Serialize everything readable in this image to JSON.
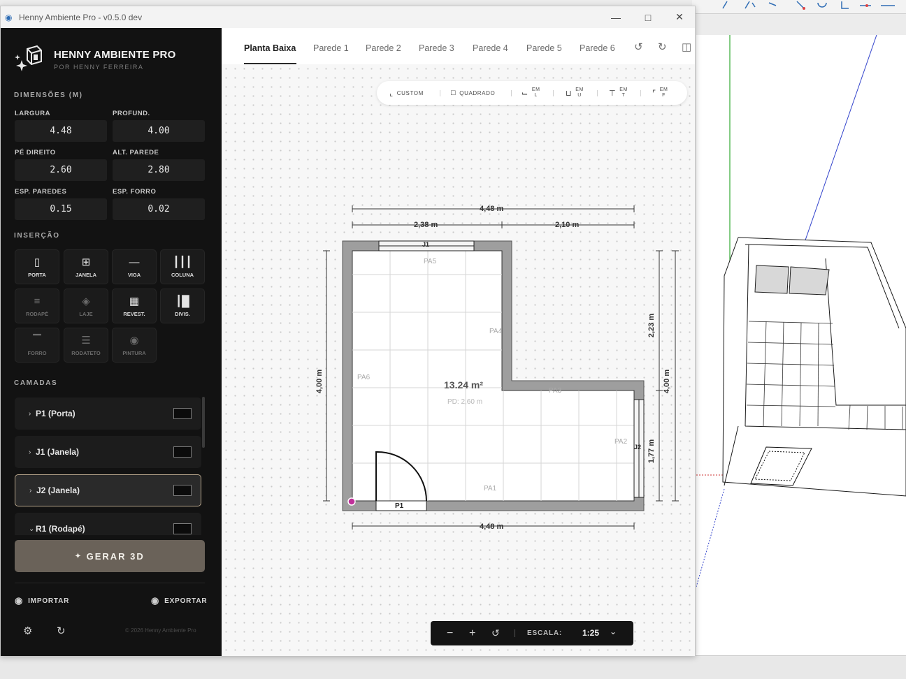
{
  "window": {
    "title": "Henny Ambiente Pro - v0.5.0 dev"
  },
  "brand": {
    "name": "HENNY AMBIENTE PRO",
    "subtitle": "POR HENNY FERREIRA"
  },
  "dimensions": {
    "section_title": "DIMENSÕES (M)",
    "fields": [
      {
        "label": "LARGURA",
        "value": "4.48"
      },
      {
        "label": "PROFUND.",
        "value": "4.00"
      },
      {
        "label": "PÉ DIREITO",
        "value": "2.60"
      },
      {
        "label": "ALT. PAREDE",
        "value": "2.80"
      },
      {
        "label": "ESP. PAREDES",
        "value": "0.15"
      },
      {
        "label": "ESP. FORRO",
        "value": "0.02"
      }
    ]
  },
  "insertion": {
    "section_title": "INSERÇÃO",
    "buttons": [
      {
        "label": "PORTA",
        "icon": "door-icon",
        "enabled": true
      },
      {
        "label": "JANELA",
        "icon": "window-icon",
        "enabled": true
      },
      {
        "label": "VIGA",
        "icon": "beam-icon",
        "enabled": true
      },
      {
        "label": "COLUNA",
        "icon": "column-icon",
        "enabled": true
      },
      {
        "label": "RODAPÉ",
        "icon": "baseboard-icon",
        "enabled": false
      },
      {
        "label": "LAJE",
        "icon": "slab-icon",
        "enabled": false
      },
      {
        "label": "REVEST.",
        "icon": "tile-icon",
        "enabled": true
      },
      {
        "label": "DIVIS.",
        "icon": "divider-icon",
        "enabled": true
      },
      {
        "label": "FORRO",
        "icon": "ceiling-icon",
        "enabled": false
      },
      {
        "label": "RODATETO",
        "icon": "crown-molding-icon",
        "enabled": false
      },
      {
        "label": "PINTURA",
        "icon": "paint-icon",
        "enabled": false
      }
    ]
  },
  "layers": {
    "section_title": "CAMADAS",
    "items": [
      {
        "name": "P1 (Porta)",
        "expanded": false,
        "selected": false
      },
      {
        "name": "J1 (Janela)",
        "expanded": false,
        "selected": false
      },
      {
        "name": "J2 (Janela)",
        "expanded": false,
        "selected": true
      },
      {
        "name": "R1 (Rodapé)",
        "expanded": true,
        "selected": false
      }
    ]
  },
  "actions": {
    "generate": "GERAR 3D",
    "import": "IMPORTAR",
    "export": "EXPORTAR"
  },
  "footer": {
    "copyright": "© 2026 Henny Ambiente Pro"
  },
  "tabs": [
    "Planta Baixa",
    "Parede 1",
    "Parede 2",
    "Parede 3",
    "Parede 4",
    "Parede 5",
    "Parede 6"
  ],
  "active_tab": "Planta Baixa",
  "shape_tools": [
    {
      "label": "CUSTOM",
      "icon": "custom-shape-icon"
    },
    {
      "label": "QUADRADO",
      "icon": "square-icon"
    },
    {
      "label": "EM L",
      "icon": "l-shape-icon"
    },
    {
      "label": "EM U",
      "icon": "u-shape-icon"
    },
    {
      "label": "EM T",
      "icon": "t-shape-icon"
    },
    {
      "label": "EM F",
      "icon": "f-shape-icon"
    }
  ],
  "plan": {
    "area": "13.24 m²",
    "ceiling_height": "PD: 2,60 m",
    "dims": {
      "top_total": "4,48 m",
      "top_left": "2,38 m",
      "top_right": "2,10 m",
      "bottom_total": "4,48 m",
      "left_total": "4,00 m",
      "right_upper": "2,23 m",
      "right_lower": "1,77 m",
      "right_total": "4,00 m"
    },
    "walls": [
      "PA1",
      "PA2",
      "PA3",
      "PA4",
      "PA5",
      "PA6"
    ],
    "openings": {
      "door": "P1",
      "window_top": "J1",
      "window_right": "J2"
    }
  },
  "zoom": {
    "scale_label": "ESCALA:",
    "scale_value": "1:25"
  }
}
